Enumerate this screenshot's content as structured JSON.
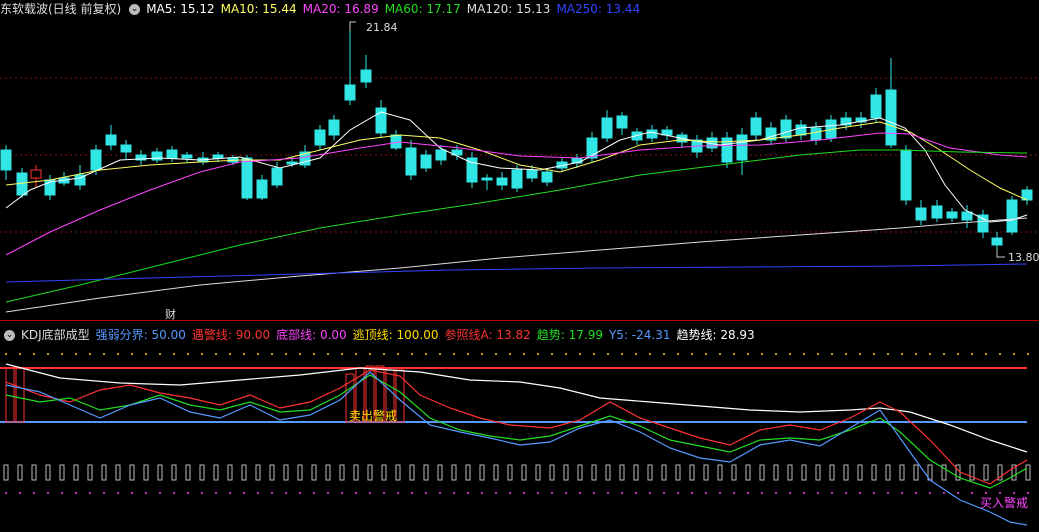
{
  "main_legend": {
    "title": "东软载波(日线 前复权)",
    "items": [
      {
        "label": "MA5: 15.12",
        "color": "#ffffff"
      },
      {
        "label": "MA10: 15.44",
        "color": "#ffff66"
      },
      {
        "label": "MA20: 16.89",
        "color": "#ff44ff"
      },
      {
        "label": "MA60: 17.17",
        "color": "#22dd22"
      },
      {
        "label": "MA120: 15.13",
        "color": "#dddddd"
      },
      {
        "label": "MA250: 13.44",
        "color": "#3344ff"
      }
    ]
  },
  "main_annotations": {
    "high": "21.84",
    "low": "13.80",
    "event_marker": "财"
  },
  "indicator_legend": {
    "title": "KDJ底部成型",
    "items": [
      {
        "label": "强弱分界: 50.00",
        "color": "#5599ff"
      },
      {
        "label": "遇警线: 90.00",
        "color": "#ff3333"
      },
      {
        "label": "底部线: 0.00",
        "color": "#ff44ff"
      },
      {
        "label": "逃顶线: 100.00",
        "color": "#ffdd00"
      },
      {
        "label": "参照线A: 13.82",
        "color": "#ff3333"
      },
      {
        "label": "趋势: 17.99",
        "color": "#22dd22"
      },
      {
        "label": "Y5: -24.31",
        "color": "#5599ff"
      },
      {
        "label": "趋势线: 28.93",
        "color": "#ffffff"
      }
    ]
  },
  "signals": {
    "sell_label": "卖出警戒",
    "buy_label": "买入警戒"
  },
  "colors": {
    "up": "#ff3333",
    "down": "#33e6e6",
    "background": "#000000"
  },
  "icons": {
    "collapse": "chevron-down-icon"
  }
}
